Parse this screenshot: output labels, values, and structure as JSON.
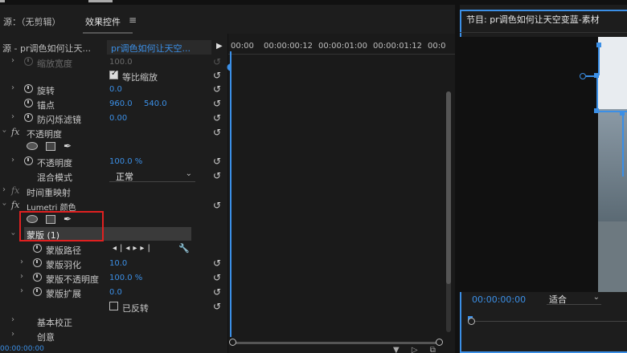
{
  "tabs": {
    "source": "源：（无剪辑）",
    "effect_controls": "效果控件",
    "menu_glyph": "≡"
  },
  "effect_controls": {
    "source_label": "源 - pr调色如何让天...",
    "clip_label": "pr调色如何让天空...",
    "rows": {
      "scale_width": {
        "label": "缩放宽度",
        "value": "100.0"
      },
      "uniform_scale": {
        "label": "等比缩放"
      },
      "rotation": {
        "label": "旋转",
        "value": "0.0"
      },
      "anchor": {
        "label": "锚点",
        "value_x": "960.0",
        "value_y": "540.0"
      },
      "anti_flicker": {
        "label": "防闪烁滤镜",
        "value": "0.00"
      },
      "opacity_group": {
        "label": "不透明度"
      },
      "opacity": {
        "label": "不透明度",
        "value": "100.0 %"
      },
      "blend_mode": {
        "label": "混合模式",
        "value": "正常"
      },
      "time_remap": {
        "label": "时间重映射"
      },
      "lumetri": {
        "label": "Lumetri 颜色"
      },
      "mask": {
        "label": "蒙版 (1)"
      },
      "mask_path": {
        "label": "蒙版路径"
      },
      "mask_feather": {
        "label": "蒙版羽化",
        "value": "10.0"
      },
      "mask_opacity": {
        "label": "蒙版不透明度",
        "value": "100.0 %"
      },
      "mask_expansion": {
        "label": "蒙版扩展",
        "value": "0.0"
      },
      "inverted": {
        "label": "已反转"
      },
      "basic_correction": {
        "label": "基本校正"
      },
      "creative": {
        "label": "创意"
      }
    },
    "bottom_timecode": "00:00:00:00"
  },
  "timeline": {
    "ticks": [
      "00:00",
      "00:00:00:12",
      "00:00:01:00",
      "00:00:01:12",
      "00:0"
    ]
  },
  "program_monitor": {
    "title": "节目: pr调色如何让天空变蓝-素材",
    "timecode": "00:00:00:00",
    "fit": "适合"
  },
  "colors": {
    "accent": "#3b8fe6",
    "highlight": "#e02020"
  }
}
